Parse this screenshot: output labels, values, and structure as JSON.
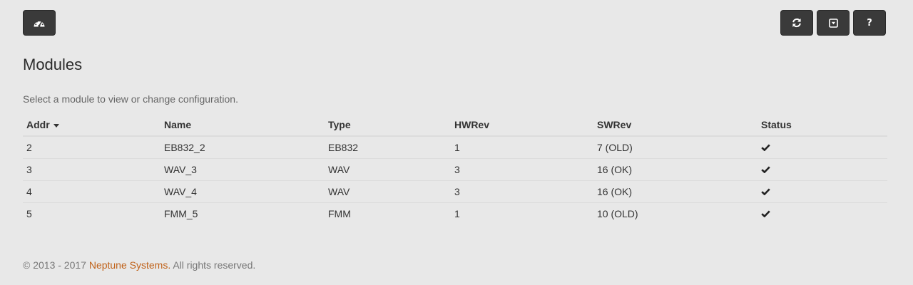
{
  "toolbar": {
    "left_icon": "dashboard-icon",
    "right_icons": [
      "refresh-icon",
      "collapse-icon",
      "help-icon"
    ],
    "help_label": "?"
  },
  "page": {
    "title": "Modules",
    "intro": "Select a module to view or change configuration."
  },
  "table": {
    "columns": [
      "Addr",
      "Name",
      "Type",
      "HWRev",
      "SWRev",
      "Status"
    ],
    "sort_column": "Addr",
    "rows": [
      {
        "addr": "2",
        "name": "EB832_2",
        "type": "EB832",
        "hwrev": "1",
        "swrev": "7 (OLD)",
        "status": "check-icon"
      },
      {
        "addr": "3",
        "name": "WAV_3",
        "type": "WAV",
        "hwrev": "3",
        "swrev": "16 (OK)",
        "status": "check-icon"
      },
      {
        "addr": "4",
        "name": "WAV_4",
        "type": "WAV",
        "hwrev": "3",
        "swrev": "16 (OK)",
        "status": "check-icon"
      },
      {
        "addr": "5",
        "name": "FMM_5",
        "type": "FMM",
        "hwrev": "1",
        "swrev": "10 (OLD)",
        "status": "check-icon"
      }
    ]
  },
  "footer": {
    "prefix": "© 2013 - 2017 ",
    "link": "Neptune Systems.",
    "suffix": " All rights reserved."
  },
  "colors": {
    "background": "#e8e8e8",
    "button": "#3a3a3a",
    "link": "#c0621a"
  }
}
